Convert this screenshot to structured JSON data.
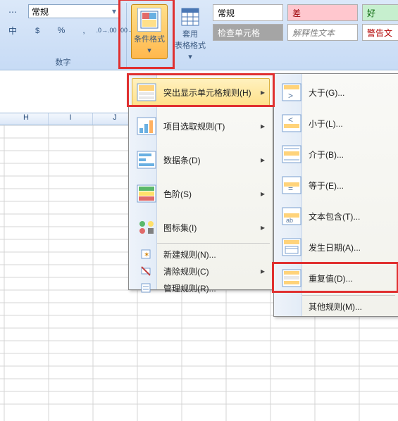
{
  "colors": {
    "accent": "#ffb84d",
    "highlight_border": "#e03030"
  },
  "ribbon": {
    "number": {
      "format_selected": "常规",
      "group_label": "数字",
      "left_label": "中",
      "percent": "%",
      "comma": ",",
      "inc_dec1": ".0",
      "inc_dec2": ".00"
    },
    "styles": {
      "cond_fmt_label": "条件格式",
      "table_fmt_label": "套用\n表格格式",
      "gallery": {
        "normal": "常规",
        "bad": "差",
        "good": "好",
        "check_cell": "检查单元格",
        "explanatory": "解释性文本",
        "warning": "警告文"
      }
    }
  },
  "columns": [
    "H",
    "I",
    "J"
  ],
  "menu1": {
    "items": [
      {
        "label": "突出显示单元格规则(H)",
        "icon": "highlight-cells"
      },
      {
        "label": "项目选取规则(T)",
        "icon": "top-bottom"
      },
      {
        "label": "数据条(D)",
        "icon": "data-bars"
      },
      {
        "label": "色阶(S)",
        "icon": "color-scales"
      },
      {
        "label": "图标集(I)",
        "icon": "icon-sets"
      }
    ],
    "small": [
      {
        "label": "新建规则(N)...",
        "icon": "new-rule"
      },
      {
        "label": "清除规则(C)",
        "icon": "clear-rules"
      },
      {
        "label": "管理规则(R)...",
        "icon": "manage-rules"
      }
    ]
  },
  "menu2": {
    "items": [
      {
        "label": "大于(G)...",
        "icon": "greater-than"
      },
      {
        "label": "小于(L)...",
        "icon": "less-than"
      },
      {
        "label": "介于(B)...",
        "icon": "between"
      },
      {
        "label": "等于(E)...",
        "icon": "equal-to"
      },
      {
        "label": "文本包含(T)...",
        "icon": "text-contains"
      },
      {
        "label": "发生日期(A)...",
        "icon": "date-occurring"
      },
      {
        "label": "重复值(D)...",
        "icon": "duplicate-values"
      }
    ],
    "other": "其他规则(M)..."
  }
}
